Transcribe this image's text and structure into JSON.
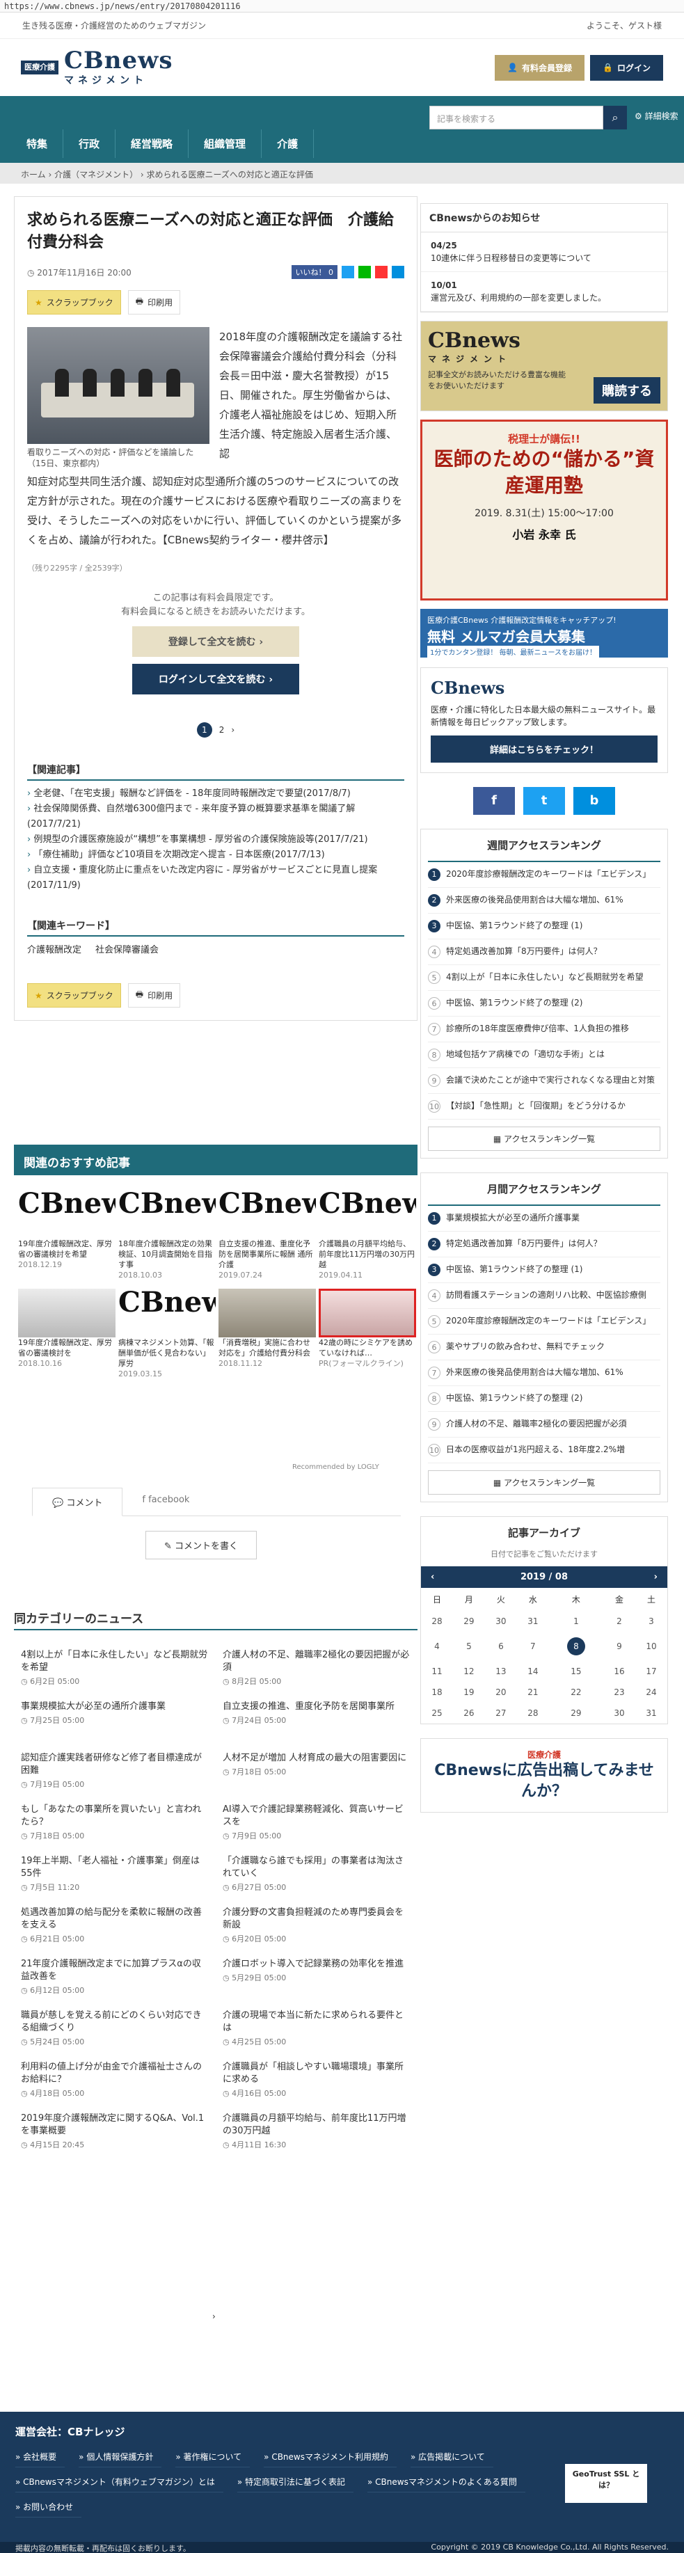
{
  "url": "https://www.cbnews.jp/news/entry/20170804201116",
  "top": {
    "tagline": "生き残る医療・介護経営のためのウェブマガジン",
    "greeting": "ようこそ、ゲスト様"
  },
  "brand": {
    "badge": "医療介護",
    "name": "CBnews",
    "sub": "マネジメント"
  },
  "header": {
    "register": "有料会員登録",
    "login": "ログイン"
  },
  "nav": {
    "items": [
      "特集",
      "行政",
      "経営戦略",
      "組織管理",
      "介護"
    ],
    "search_placeholder": "記事を検索する",
    "detail": "詳細検索"
  },
  "breadcrumb": "ホーム › 介護（マネジメント） › 求められる医療ニーズへの対応と適正な評価",
  "article": {
    "title": "求められる医療ニーズへの対応と適正な評価　介護給付費分科会",
    "date": "2017年11月16日 20:00",
    "like": "いいね！ 0",
    "scrap": "スクラップブック",
    "print": "印刷用",
    "caption": "看取りニーズへの対応・評価などを議論した（15日、東京都内）",
    "lead": "2018年度の介護報酬改定を議論する社会保障審議会介護給付費分科会（分科会長＝田中滋・慶大名誉教授）が15日、開催された。厚生労働省からは、介護老人福祉施設をはじめ、短期入所生活介護、特定施設入居者生活介護、認",
    "body": "知症対応型共同生活介護、認知症対応型通所介護の5つのサービスについての改定方針が示された。現在の介護サービスにおける医療や看取りニーズの高まりを受け、そうしたニーズへの対応をいかに行い、評価していくのかという提案が多くを占め、議論が行われた。【CBnews契約ライター・櫻井啓示】",
    "chars": "（残り2295字 / 全2539字）",
    "member_note_1": "この記事は有料会員限定です。",
    "member_note_2": "有料会員になると続きをお読みいただけます。",
    "cta_register": "登録して全文を読む ›",
    "cta_login": "ログインして全文を読む ›",
    "pages": [
      "1",
      "2",
      "›"
    ],
    "related_h": "【関連記事】",
    "related": [
      "全老健、「在宅支援」報酬など評価を - 18年度同時報酬改定で要望(2017/8/7)",
      "社会保障関係費、自然増6300億円まで - 来年度予算の概算要求基準を閣議了解(2017/7/21)",
      "例規型の介護医療施設が“構想”を事業構想 - 厚労省の介護保険施設等(2017/7/21)",
      "「療住補助」評価など10項目を次期改定へ提言 - 日本医療(2017/7/13)",
      "自立支援・重度化防止に重点をいた改定内容に - 厚労省がサービスごとに見直し提案(2017/11/9)"
    ],
    "keyword_h": "【関連キーワード】",
    "keywords": [
      "介護報酬改定",
      "社会保障審議会"
    ]
  },
  "recommend": {
    "title": "関連のおすすめ記事",
    "items": [
      {
        "text": "19年度介護報酬改定、厚労省の審議検討を希望",
        "date": "2018.12.19"
      },
      {
        "text": "18年度介護報酬改定の効果検証、10月調査開始を目指す事",
        "date": "2018.10.03"
      },
      {
        "text": "自立支援の推進、重度化予防を居関事業所に報酬 通所介護",
        "date": "2019.07.24"
      },
      {
        "text": "介護職員の月額平均給与、前年度比11万円増の30万円越",
        "date": "2019.04.11"
      },
      {
        "text": "19年度介護報酬改定、厚労省の審議検討を",
        "date": "2018.10.16"
      },
      {
        "text": "病棟マネジメント効算、「報酬単価が低く見合わない」厚労",
        "date": "2019.03.15"
      },
      {
        "text": "「消費増税」実施に合わせ対応を」介護給付費分科会",
        "date": "2018.11.12"
      },
      {
        "text": "42歳の時にシミケアを誘めていなければ…",
        "date": "PR(フォーマルクライン)"
      }
    ],
    "footer": "Recommended by LOGLY"
  },
  "comments": {
    "tab_comment": "コメント",
    "tab_facebook": "facebook",
    "write": "コメントを書く"
  },
  "category": {
    "title": "同カテゴリーのニュース",
    "items": [
      {
        "text": "4割以上が「日本に永住したい」など長期就労を希望",
        "date": "6月2日 05:00"
      },
      {
        "text": "介護人材の不足、離職率2極化の要因把握が必須",
        "date": "8月2日 05:00"
      },
      {
        "text": "事業規模拡大が必至の通所介護事業",
        "date": "7月25日 05:00"
      },
      {
        "text": "自立支援の推進、重度化予防を居関事業所",
        "date": "7月24日 05:00"
      },
      {
        "text": "認知症介護実践者研修など修了者目標達成が困難",
        "date": "7月19日 05:00"
      },
      {
        "text": "人材不足が増加 人材育成の最大の阻害要因に",
        "date": "7月18日 05:00"
      },
      {
        "text": "もし「あなたの事業所を買いたい」と言われたら？",
        "date": "7月18日 05:00"
      },
      {
        "text": "AI導入で介護記録業務軽減化、質高いサービスを",
        "date": "7月9日 05:00"
      },
      {
        "text": "19年上半期、「老人福祉・介護事業」倒産は55件",
        "date": "7月5日 11:20"
      },
      {
        "text": "「介護職なら誰でも採用」の事業者は淘汰されていく",
        "date": "6月27日 05:00"
      },
      {
        "text": "処遇改善加算の給与配分を柔軟に報酬の改善を支える",
        "date": "6月21日 05:00"
      },
      {
        "text": "介護分野の文書負担軽減のため専門委員会を新設",
        "date": "6月20日 05:00"
      },
      {
        "text": "21年度介護報酬改定までに加算プラスαの収益改善を",
        "date": "6月12日 05:00"
      },
      {
        "text": "介護ロボット導入で記録業務の効率化を推進",
        "date": "5月29日 05:00"
      },
      {
        "text": "職員が慈しを覚える前にどのくらい対応できる組織づくり",
        "date": "5月24日 05:00"
      },
      {
        "text": "介護の現場で本当に新たに求められる要件とは",
        "date": "4月25日 05:00"
      },
      {
        "text": "利用料の値上げ分が由金で介護福祉士さんのお給料に？",
        "date": "4月18日 05:00"
      },
      {
        "text": "介護職員が「相談しやすい職場環境」事業所に求める",
        "date": "4月16日 05:00"
      },
      {
        "text": "2019年度介護報酬改定に関するQ&A、Vol.1を事業概要",
        "date": "4月15日 20:45"
      },
      {
        "text": "介護職員の月額平均給与、前年度比11万円増の30万円越",
        "date": "4月11日 16:30"
      }
    ],
    "next": "›"
  },
  "sidebar": {
    "notice_h": "CBnewsからのお知らせ",
    "notices": [
      {
        "date": "04/25",
        "text": "10連休に伴う日程移替日の変更等について"
      },
      {
        "date": "10/01",
        "text": "運営元及び、利用規約の一部を変更しました。"
      }
    ],
    "ad1": {
      "title": "CBnews",
      "sub": "マネジメント",
      "text": "記事全文がお読みいただける豊富な機能をお使いいただけます",
      "btn": "購読する"
    },
    "ad2": {
      "t1": "税理士が講伝!!",
      "t2": "医師のための“儲かる”資産運用塾",
      "t3": "2019. 8.31(土) 15:00～17:00",
      "t4": "小岩 永幸 氏"
    },
    "ad3": {
      "small": "医療介護CBnews 介護報酬改定情報をキャッチアップ!",
      "big": "無料 メルマガ会員大募集",
      "note": "1分でカンタン登録！ 毎朝、最新ニュースをお届け！"
    },
    "mag": {
      "title": "CBnews",
      "text": "医療・介護に特化した日本最大級の無料ニュースサイト。最新情報を毎日ピックアップ致します。",
      "btn": "詳細はこちらをチェック！"
    },
    "sns": [
      "f",
      "t",
      "b"
    ],
    "rank_week_h": "週間アクセスランキング",
    "rank_week": [
      "2020年度診療報酬改定のキーワードは「エビデンス」",
      "外来医療の後発品使用割合は大幅な増加、61%",
      "中医協、第1ラウンド終了の整理 (1)",
      "特定処遇改善加算「8万円要件」は何人？",
      "4割以上が「日本に永住したい」など長期就労を希望",
      "中医協、第1ラウンド終了の整理 (2)",
      "診療所の18年度医療費伸び倍率、1人負担の推移",
      "地域包括ケア病棟での「適切な手術」とは",
      "会議で決めたことが途中で実行されなくなる理由と対策",
      "【対談】「急性期」と「回復期」をどう分けるか"
    ],
    "rank_month_h": "月間アクセスランキング",
    "rank_month": [
      "事業規模拡大が必至の通所介護事業",
      "特定処遇改善加算「8万円要件」は何人？",
      "中医協、第1ラウンド終了の整理 (1)",
      "訪問看護ステーションの適剤リハ比較、中医協診療側",
      "2020年度診療報酬改定のキーワードは「エビデンス」",
      "薬やサプリの飲み合わせ、無料でチェック",
      "外来医療の後発品使用割合は大幅な増加、61%",
      "中医協、第1ラウンド終了の整理 (2)",
      "介護人材の不足、離職率2極化の要因把握が必須",
      "日本の医療収益が1兆円超える、18年度2.2%増"
    ],
    "rank_all": "アクセスランキング一覧",
    "archive_h": "記事アーカイブ",
    "archive_sub": "日付で記事をご覧いただけます",
    "cal_month": "2019 / 08",
    "cal_head": [
      "日",
      "月",
      "火",
      "水",
      "木",
      "金",
      "土"
    ],
    "cal_rows": [
      [
        "28",
        "29",
        "30",
        "31",
        "1",
        "2",
        "3"
      ],
      [
        "4",
        "5",
        "6",
        "7",
        "8",
        "9",
        "10"
      ],
      [
        "11",
        "12",
        "13",
        "14",
        "15",
        "16",
        "17"
      ],
      [
        "18",
        "19",
        "20",
        "21",
        "22",
        "23",
        "24"
      ],
      [
        "25",
        "26",
        "27",
        "28",
        "29",
        "30",
        "31"
      ]
    ],
    "cal_today": "8",
    "ad4": {
      "small": "医療介護",
      "text": "CBnewsに広告出稿してみませんか？"
    }
  },
  "footer": {
    "company": "運営会社：CBナレッジ",
    "links": [
      "会社概要",
      "個人情報保護方針",
      "著作権について",
      "CBnewsマネジメント利用規約",
      "広告掲載について",
      "CBnewsマネジメント（有料ウェブマガジン）とは",
      "特定商取引法に基づく表記",
      "CBnewsマネジメントのよくある質問",
      "お問い合わせ"
    ],
    "geotrust": "GeoTrust SSL とは？",
    "note": "掲載内容の無断転載・再配布は固くお断りします。",
    "copyright": "Copyright © 2019 CB Knowledge Co.,Ltd. All Rights Reserved."
  },
  "colors": {
    "navy": "#1b3a5c",
    "teal": "#1f6b7a",
    "gold": "#b8a36b"
  }
}
